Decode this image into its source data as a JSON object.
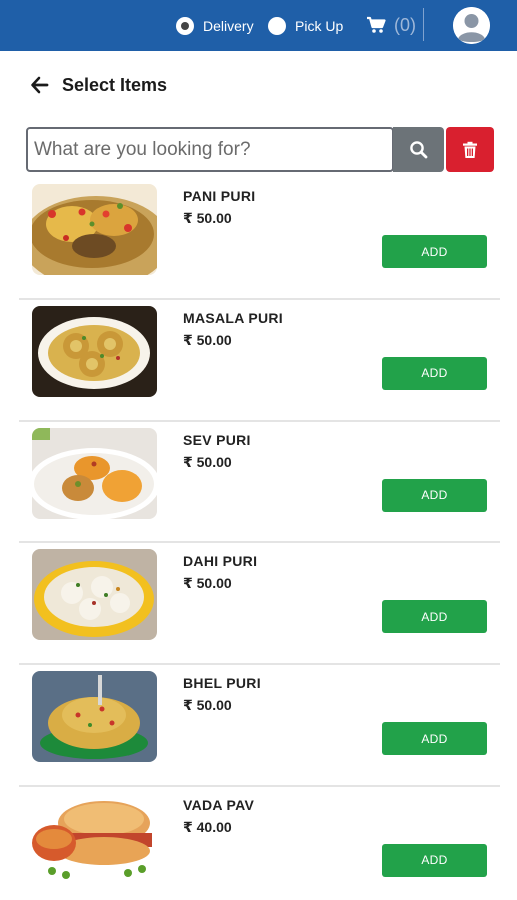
{
  "topbar": {
    "delivery_label": "Delivery",
    "pickup_label": "Pick Up",
    "selected_mode": "Delivery",
    "cart_count": "(0)",
    "bar_color": "#1f5fa8"
  },
  "header": {
    "title": "Select Items"
  },
  "search": {
    "placeholder": "What are you looking for?",
    "value": ""
  },
  "items": [
    {
      "name": "PANI PURI",
      "price": "₹ 50.00",
      "add_label": "ADD"
    },
    {
      "name": "MASALA PURI",
      "price": "₹ 50.00",
      "add_label": "ADD"
    },
    {
      "name": "SEV PURI",
      "price": "₹ 50.00",
      "add_label": "ADD"
    },
    {
      "name": "DAHI PURI",
      "price": "₹ 50.00",
      "add_label": "ADD"
    },
    {
      "name": "BHEL PURI",
      "price": "₹ 50.00",
      "add_label": "ADD"
    },
    {
      "name": "VADA PAV",
      "price": "₹ 40.00",
      "add_label": "ADD"
    }
  ],
  "colors": {
    "accent": "#1f5fa8",
    "add_button": "#22a24a",
    "clear_button": "#d9202f",
    "search_button": "#6c7378"
  }
}
